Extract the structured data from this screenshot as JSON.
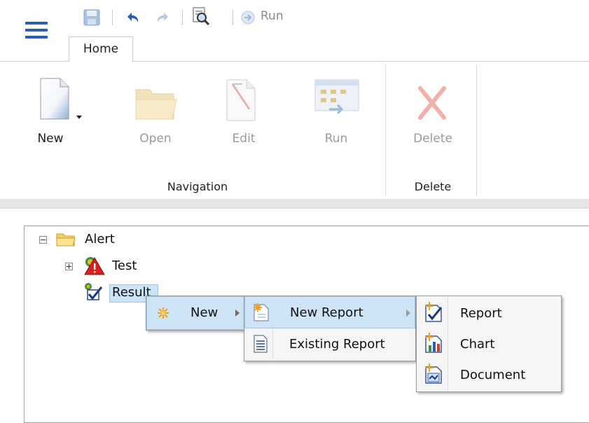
{
  "quick_access": {
    "run_label": "Run",
    "icons": [
      "save-icon",
      "undo-icon",
      "redo-icon",
      "preview-icon",
      "run-icon"
    ]
  },
  "tabs": [
    {
      "label": "Home",
      "active": true
    }
  ],
  "ribbon": {
    "groups": [
      {
        "label": "Navigation",
        "buttons": [
          {
            "label": "New",
            "enabled": true,
            "icon": "new-document-icon",
            "has_dropdown": true
          },
          {
            "label": "Open",
            "enabled": false,
            "icon": "open-folder-icon"
          },
          {
            "label": "Edit",
            "enabled": false,
            "icon": "edit-document-icon"
          },
          {
            "label": "Run",
            "enabled": false,
            "icon": "run-report-icon"
          }
        ]
      },
      {
        "label": "Delete",
        "buttons": [
          {
            "label": "Delete",
            "enabled": false,
            "icon": "delete-x-icon"
          }
        ]
      }
    ]
  },
  "tree": {
    "root": {
      "label": "Alert",
      "expanded": true,
      "icon": "folder-icon"
    },
    "children": [
      {
        "label": "Test",
        "expanded": false,
        "icon": "alert-icon"
      },
      {
        "label": "Result",
        "selected": true,
        "icon": "result-icon"
      }
    ]
  },
  "context_menu": {
    "level1": [
      {
        "label": "New",
        "icon": "new-star-icon",
        "has_submenu": true
      }
    ],
    "level2": [
      {
        "label": "New Report",
        "icon": "new-report-icon",
        "has_submenu": true,
        "highlighted": true
      },
      {
        "label": "Existing Report",
        "icon": "existing-report-icon"
      }
    ],
    "level3": [
      {
        "label": "Report",
        "icon": "report-icon"
      },
      {
        "label": "Chart",
        "icon": "chart-icon"
      },
      {
        "label": "Document",
        "icon": "document-icon"
      }
    ]
  },
  "colors": {
    "accent": "#2a5db0",
    "highlight": "#cfe3f7",
    "highlight_border": "#9ec6ea"
  }
}
